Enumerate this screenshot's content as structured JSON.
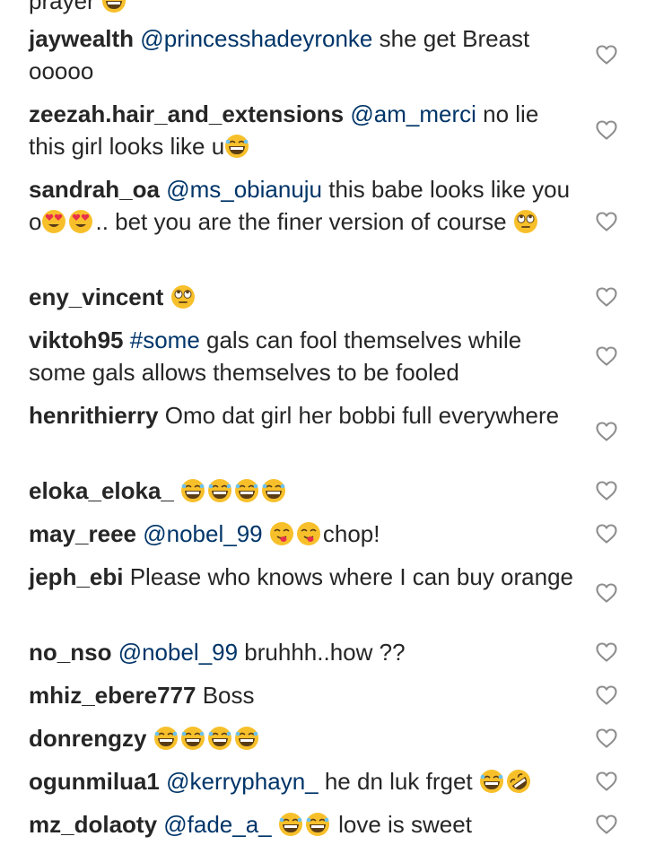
{
  "comments": [
    {
      "segments": [
        {
          "t": "text",
          "v": "prayer "
        },
        {
          "t": "emoji",
          "e": "grin-sweat"
        }
      ],
      "lines": 1,
      "cutoff": true
    },
    {
      "user": "jaywealth",
      "segments": [
        {
          "t": "mention",
          "v": "@princesshadeyronke"
        },
        {
          "t": "text",
          "v": " she get Breast ooooo"
        }
      ],
      "lines": 2
    },
    {
      "user": "zeezah.hair_and_extensions",
      "segments": [
        {
          "t": "mention",
          "v": "@am_merci"
        },
        {
          "t": "text",
          "v": " no lie this girl looks like u"
        },
        {
          "t": "emoji",
          "e": "grin-sweat"
        }
      ],
      "lines": 2
    },
    {
      "user": "sandrah_oa",
      "segments": [
        {
          "t": "mention",
          "v": "@ms_obianuju"
        },
        {
          "t": "text",
          "v": " this babe looks like you o"
        },
        {
          "t": "emoji",
          "e": "heart-eyes"
        },
        {
          "t": "emoji",
          "e": "heart-eyes"
        },
        {
          "t": "text",
          "v": ".. bet you are the finer version of course "
        },
        {
          "t": "emoji",
          "e": "rolling-eyes"
        }
      ],
      "lines": 3
    },
    {
      "user": "eny_vincent",
      "segments": [
        {
          "t": "emoji",
          "e": "rolling-eyes"
        }
      ],
      "lines": 1
    },
    {
      "user": "viktoh95",
      "segments": [
        {
          "t": "tag",
          "v": "#some"
        },
        {
          "t": "text",
          "v": " gals can fool themselves while some gals allows themselves to be fooled"
        }
      ],
      "lines": 2
    },
    {
      "user": "henrithierry",
      "segments": [
        {
          "t": "text",
          "v": "Omo dat girl her bobbi full everywhere"
        }
      ],
      "lines": 2
    },
    {
      "user": "eloka_eloka_",
      "segments": [
        {
          "t": "emoji",
          "e": "grin-sweat"
        },
        {
          "t": "emoji",
          "e": "grin-sweat"
        },
        {
          "t": "emoji",
          "e": "grin-sweat"
        },
        {
          "t": "emoji",
          "e": "grin-sweat"
        }
      ],
      "lines": 1
    },
    {
      "user": "may_reee",
      "segments": [
        {
          "t": "mention",
          "v": "@nobel_99"
        },
        {
          "t": "text",
          "v": " "
        },
        {
          "t": "emoji",
          "e": "yum"
        },
        {
          "t": "emoji",
          "e": "yum"
        },
        {
          "t": "text",
          "v": "chop!"
        }
      ],
      "lines": 1
    },
    {
      "user": "jeph_ebi",
      "segments": [
        {
          "t": "text",
          "v": "Please who knows where I can buy orange"
        }
      ],
      "lines": 2
    },
    {
      "user": "no_nso",
      "segments": [
        {
          "t": "mention",
          "v": "@nobel_99"
        },
        {
          "t": "text",
          "v": " bruhhh..how ??"
        }
      ],
      "lines": 1
    },
    {
      "user": "mhiz_ebere777",
      "segments": [
        {
          "t": "text",
          "v": "Boss"
        }
      ],
      "lines": 1
    },
    {
      "user": "donrengzy",
      "segments": [
        {
          "t": "emoji",
          "e": "grin-sweat"
        },
        {
          "t": "emoji",
          "e": "grin-sweat"
        },
        {
          "t": "emoji",
          "e": "grin-sweat"
        },
        {
          "t": "emoji",
          "e": "grin-sweat"
        }
      ],
      "lines": 1
    },
    {
      "user": "ogunmilua1",
      "segments": [
        {
          "t": "mention",
          "v": "@kerryphayn_"
        },
        {
          "t": "text",
          "v": " he dn luk frget "
        },
        {
          "t": "emoji",
          "e": "grin-sweat"
        },
        {
          "t": "emoji",
          "e": "rofl"
        }
      ],
      "lines": 1
    },
    {
      "user": "mz_dolaoty",
      "segments": [
        {
          "t": "mention",
          "v": "@fade_a_"
        },
        {
          "t": "text",
          "v": " "
        },
        {
          "t": "emoji",
          "e": "grin-sweat"
        },
        {
          "t": "emoji",
          "e": "grin-sweat"
        },
        {
          "t": "text",
          "v": " love is sweet"
        }
      ],
      "lines": 1
    }
  ],
  "icons": {
    "like": "heart-outline-icon"
  },
  "colors": {
    "text": "#262626",
    "mention": "#003569",
    "heart": "#8e8e8e",
    "emoji_face": "#f7c02b"
  }
}
